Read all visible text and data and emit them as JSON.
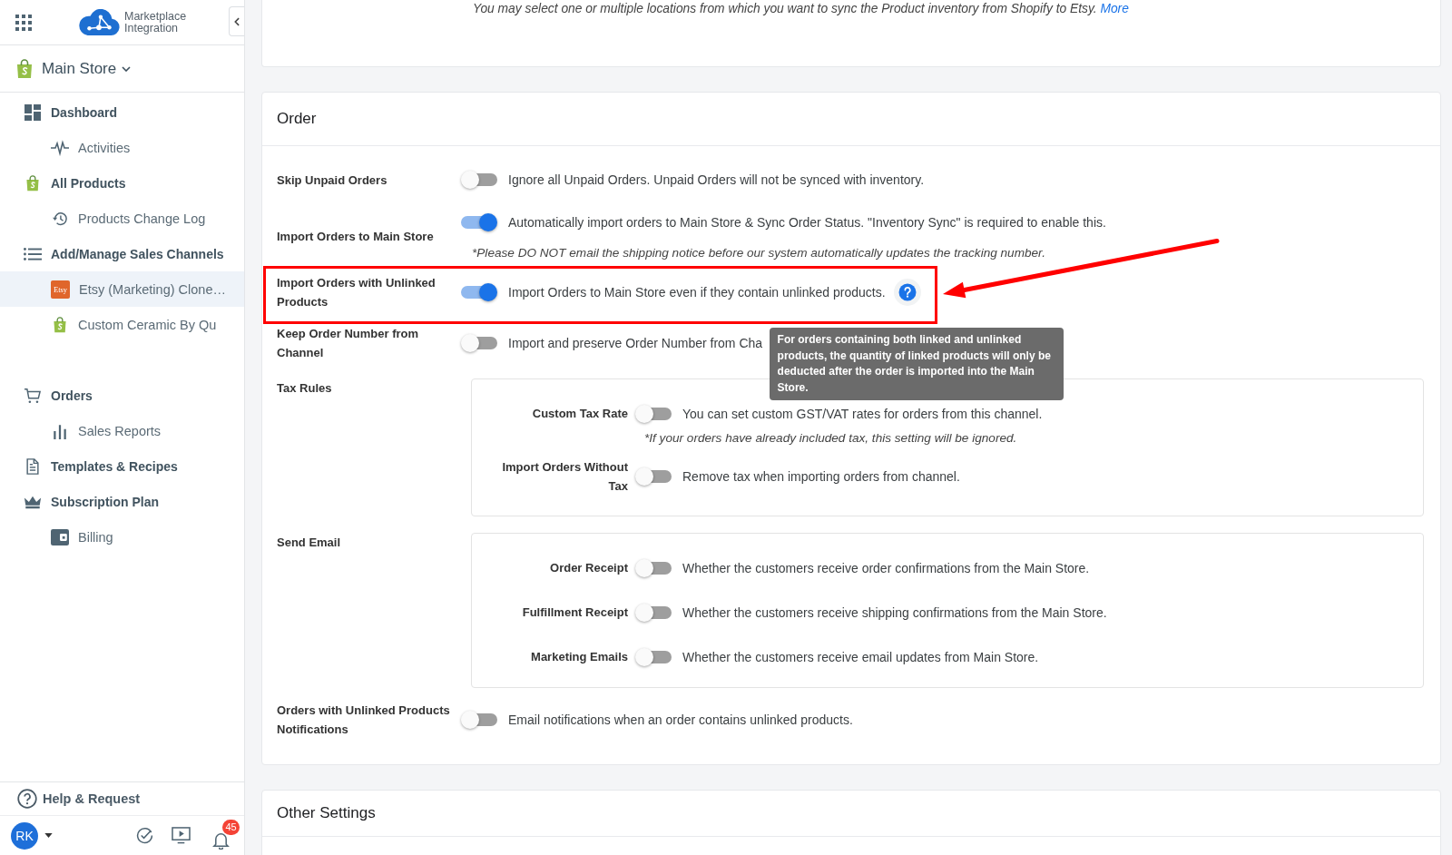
{
  "app": {
    "logo_text": "Marketplace Integration"
  },
  "store": {
    "name": "Main Store"
  },
  "sidebar": {
    "sections": [
      {
        "items": [
          {
            "label": "Dashboard",
            "selected": false,
            "children": [
              {
                "label": "Activities",
                "selected": false
              }
            ]
          },
          {
            "label": "All Products",
            "selected": false,
            "children": [
              {
                "label": "Products Change Log",
                "selected": false
              }
            ]
          },
          {
            "label": "Add/Manage Sales Channels",
            "selected": false,
            "children": [
              {
                "label": "Etsy (Marketing) Clone…",
                "selected": true,
                "logo_text": "Etsy"
              },
              {
                "label": "Custom Ceramic By Qu",
                "selected": false
              }
            ]
          }
        ]
      },
      {
        "items": [
          {
            "label": "Orders",
            "selected": false,
            "children": [
              {
                "label": "Sales Reports",
                "selected": false
              }
            ]
          },
          {
            "label": "Templates & Recipes",
            "selected": false
          },
          {
            "label": "Subscription Plan",
            "selected": false,
            "children": [
              {
                "label": "Billing",
                "selected": false
              }
            ]
          }
        ]
      }
    ]
  },
  "help": {
    "label": "Help & Request"
  },
  "user": {
    "initials": "RK",
    "notification_count": "45"
  },
  "location_card": {
    "hint": "You may select one or multiple locations from which you want to sync the Product inventory from Shopify to Etsy.",
    "link": "More"
  },
  "order": {
    "title": "Order",
    "rows": [
      {
        "kind": "toggle",
        "label": "Skip Unpaid Orders",
        "on": false,
        "description": "Ignore all Unpaid Orders. Unpaid Orders will not be synced with inventory.",
        "highlighted": false
      },
      {
        "kind": "toggle",
        "label": "Import Orders to Main Store",
        "on": true,
        "description": "Automatically import orders to Main Store & Sync Order Status. \"Inventory Sync\" is required to enable this.",
        "note": "*Please DO NOT email the shipping notice before our system automatically updates the tracking number.",
        "highlighted": false
      },
      {
        "kind": "toggle",
        "label": "Import Orders with Unlinked Products",
        "on": true,
        "description": "Import Orders to Main Store even if they contain unlinked products.",
        "help": {
          "tooltip": "For orders containing both linked and unlinked products, the quantity of linked products will only be deducted after the order is imported into the Main Store.",
          "open": true
        },
        "highlighted": true
      },
      {
        "kind": "toggle",
        "label": "Keep Order Number from Channel",
        "on": false,
        "description": "Import and preserve Order Number from Cha",
        "highlighted": false
      },
      {
        "kind": "group",
        "label": "Tax Rules",
        "highlighted": false,
        "items": [
          {
            "label": "Custom Tax Rate",
            "on": false,
            "description": "You can set custom GST/VAT rates for orders from this channel.",
            "note": "*If your orders have already included tax, this setting will be ignored."
          },
          {
            "label": "Import Orders Without Tax",
            "on": false,
            "description": "Remove tax when importing orders from channel."
          }
        ]
      },
      {
        "kind": "group",
        "label": "Send Email",
        "highlighted": false,
        "items": [
          {
            "label": "Order Receipt",
            "on": false,
            "description": "Whether the customers receive order confirmations from the Main Store."
          },
          {
            "label": "Fulfillment Receipt",
            "on": false,
            "description": "Whether the customers receive shipping confirmations from the Main Store."
          },
          {
            "label": "Marketing Emails",
            "on": false,
            "description": "Whether the customers receive email updates from Main Store."
          }
        ]
      },
      {
        "kind": "toggle",
        "label": "Orders with Unlinked Products Notifications",
        "on": false,
        "description": "Email notifications when an order contains unlinked products.",
        "highlighted": false
      }
    ]
  },
  "other_settings": {
    "title": "Other Settings"
  }
}
